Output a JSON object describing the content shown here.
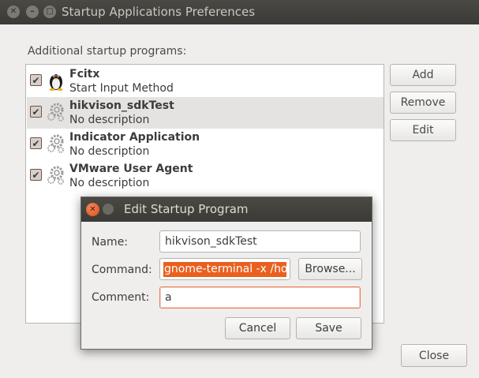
{
  "window": {
    "title": "Startup Applications Preferences",
    "section_label": "Additional startup programs:",
    "close_label": "Close"
  },
  "side_buttons": {
    "add": "Add",
    "remove": "Remove",
    "edit": "Edit"
  },
  "programs": [
    {
      "name": "Fcitx",
      "description": "Start Input Method",
      "checked": true,
      "icon": "penguin-icon"
    },
    {
      "name": "hikvison_sdkTest",
      "description": "No description",
      "checked": true,
      "icon": "gears-icon"
    },
    {
      "name": "Indicator Application",
      "description": "No description",
      "checked": true,
      "icon": "gears-icon"
    },
    {
      "name": "VMware User Agent",
      "description": "No description",
      "checked": true,
      "icon": "gears-icon"
    }
  ],
  "dialog": {
    "title": "Edit Startup Program",
    "name_label": "Name:",
    "name_value": "hikvison_sdkTest",
    "command_label": "Command:",
    "command_value": "gnome-terminal -x /hor",
    "browse_label": "Browse...",
    "comment_label": "Comment:",
    "comment_value": "a",
    "cancel_label": "Cancel",
    "save_label": "Save"
  },
  "colors": {
    "accent": "#e9601f",
    "titlebar": "#3c3b37"
  }
}
